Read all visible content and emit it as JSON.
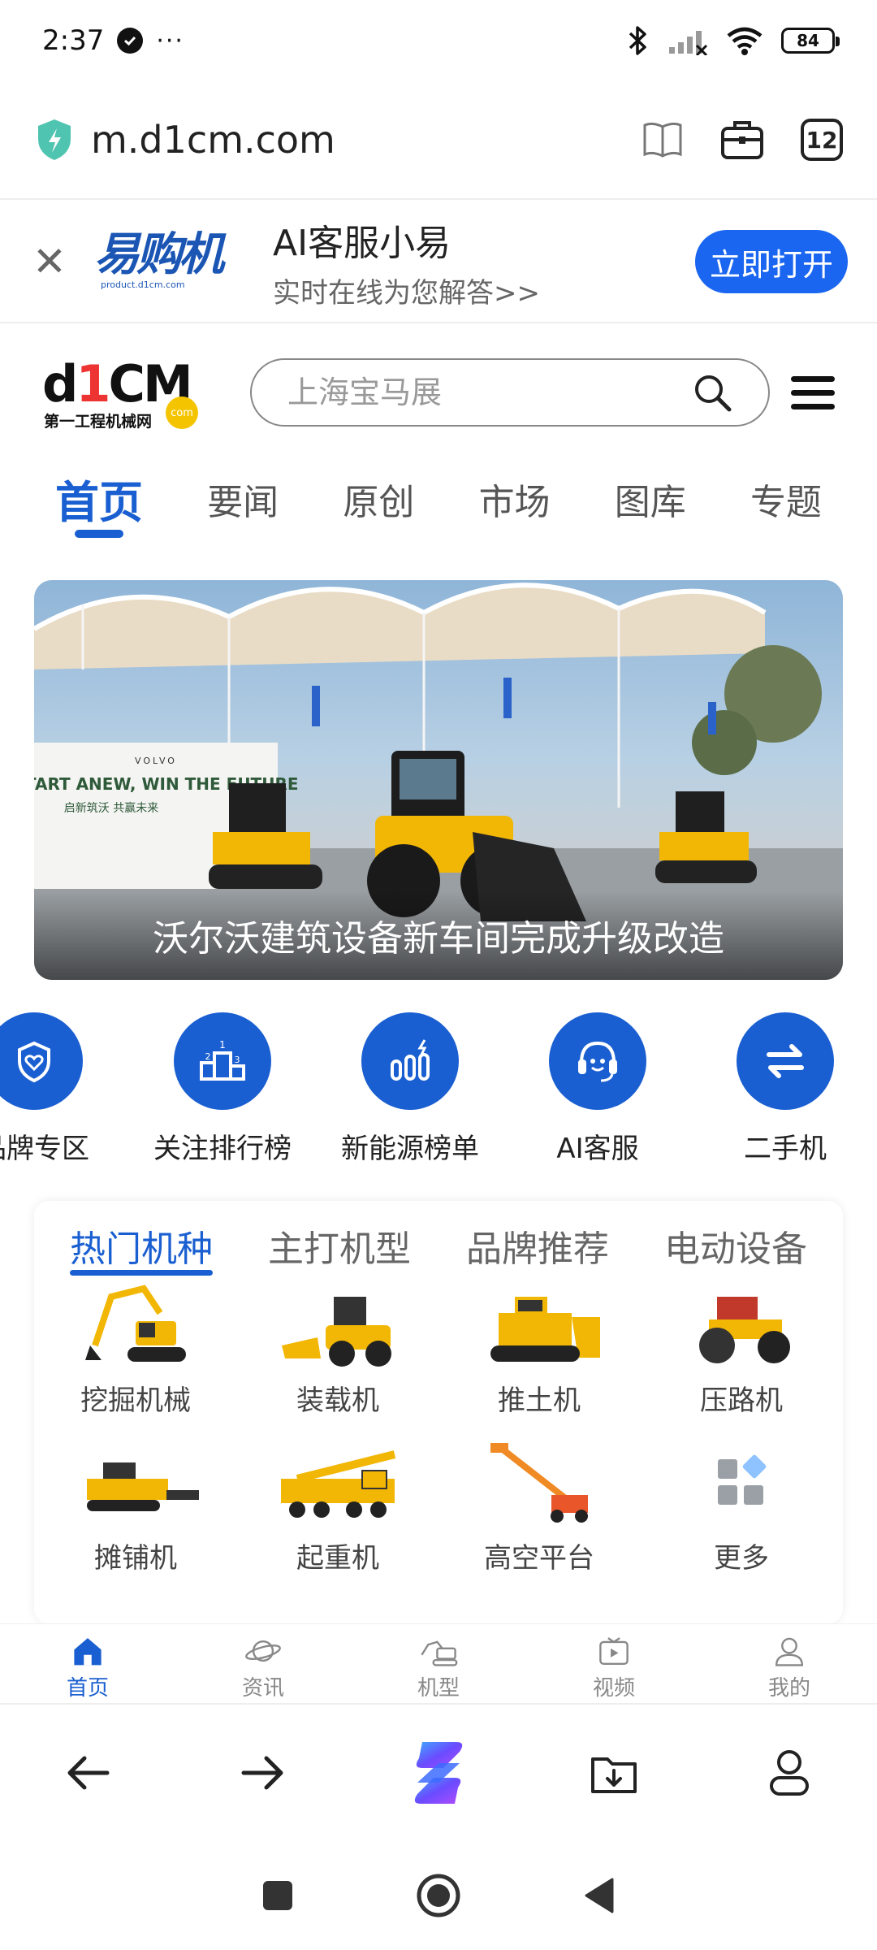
{
  "status": {
    "time": "2:37",
    "dots": "···",
    "battery": "84"
  },
  "browser": {
    "url": "m.d1cm.com",
    "tab_count": "12"
  },
  "promo": {
    "close": "✕",
    "logo_text": "易购机",
    "logo_sub": "product.d1cm.com",
    "title": "AI客服小易",
    "subtitle": "实时在线为您解答>>",
    "button": "立即打开"
  },
  "site": {
    "logo_prefix": "d",
    "logo_one": "1",
    "logo_suffix": "CM",
    "logo_sub": "第一工程机械网",
    "logo_badge": "com",
    "search_placeholder": "上海宝马展"
  },
  "nav_tabs": [
    {
      "label": "首页",
      "active": true
    },
    {
      "label": "要闻"
    },
    {
      "label": "原创"
    },
    {
      "label": "市场"
    },
    {
      "label": "图库"
    },
    {
      "label": "专题"
    }
  ],
  "hero": {
    "caption": "沃尔沃建筑设备新车间完成升级改造",
    "banner_brand": "VOLVO",
    "banner_slogan": "START ANEW, WIN THE FUTURE",
    "banner_slogan_cn": "启新筑沃 共赢未来"
  },
  "quick_links": [
    {
      "label": "品牌专区",
      "icon": "shield-heart-icon"
    },
    {
      "label": "关注排行榜",
      "icon": "podium-icon"
    },
    {
      "label": "新能源榜单",
      "icon": "energy-bars-icon"
    },
    {
      "label": "AI客服",
      "icon": "headset-icon"
    },
    {
      "label": "二手机",
      "icon": "swap-arrows-icon"
    }
  ],
  "category_tabs": [
    {
      "label": "热门机种",
      "active": true
    },
    {
      "label": "主打机型"
    },
    {
      "label": "品牌推荐"
    },
    {
      "label": "电动设备"
    }
  ],
  "categories": [
    {
      "label": "挖掘机械",
      "icon": "excavator-icon"
    },
    {
      "label": "装载机",
      "icon": "loader-icon"
    },
    {
      "label": "推土机",
      "icon": "bulldozer-icon"
    },
    {
      "label": "压路机",
      "icon": "road-roller-icon"
    },
    {
      "label": "摊铺机",
      "icon": "paver-icon"
    },
    {
      "label": "起重机",
      "icon": "crane-icon"
    },
    {
      "label": "高空平台",
      "icon": "aerial-platform-icon"
    },
    {
      "label": "更多",
      "icon": "grid-more-icon"
    }
  ],
  "site_nav": [
    {
      "label": "首页",
      "active": true,
      "icon": "home-icon"
    },
    {
      "label": "资讯",
      "icon": "planet-icon"
    },
    {
      "label": "机型",
      "icon": "machine-icon"
    },
    {
      "label": "视频",
      "icon": "tv-play-icon"
    },
    {
      "label": "我的",
      "icon": "user-icon"
    }
  ],
  "colors": {
    "accent": "#1a5fd1",
    "button": "#1a66f0",
    "machine_yellow": "#f2b705"
  }
}
